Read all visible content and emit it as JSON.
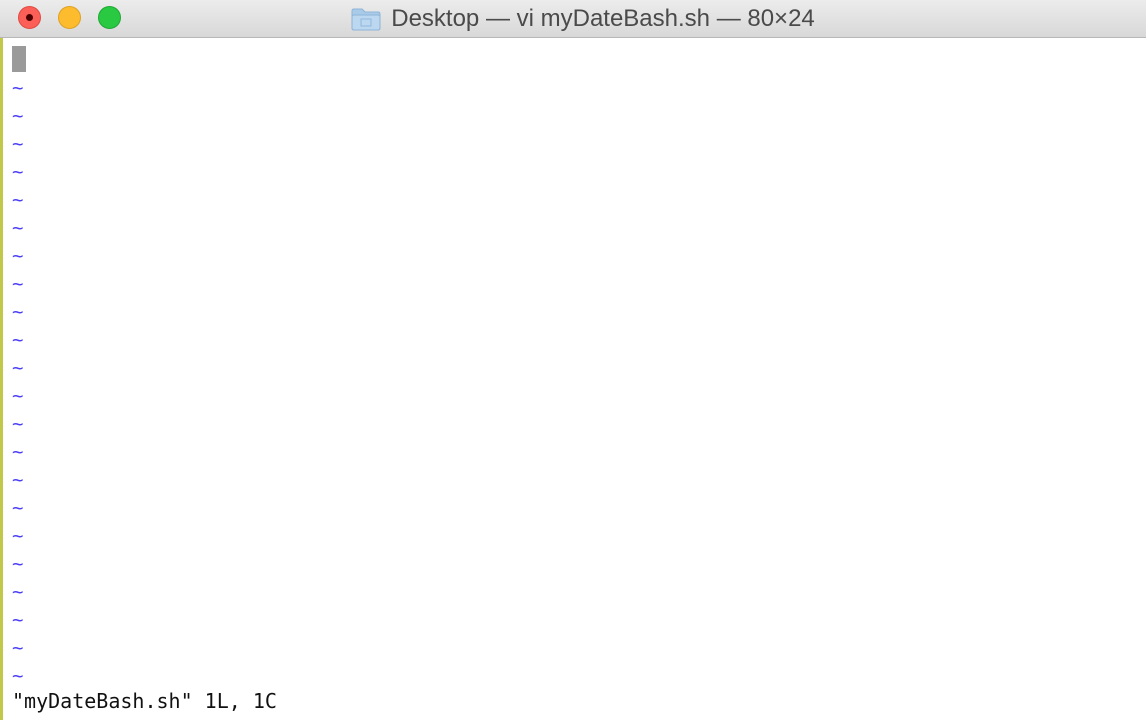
{
  "window": {
    "title": "Desktop — vi myDateBash.sh — 80×24",
    "folder_icon": "folder-icon",
    "controls": {
      "close": "close-icon",
      "minimize": "minimize-icon",
      "zoom": "zoom-icon"
    }
  },
  "editor": {
    "empty_line_marker": "~",
    "empty_line_count": 22,
    "status_message": "\"myDateBash.sh\" 1L, 1C",
    "cursor_color": "#9a9a9a",
    "tilde_color": "#4b3df5"
  },
  "colors": {
    "close": "#fc5f57",
    "minimize": "#fdbc2e",
    "zoom": "#29c941",
    "left_border": "#c2c84a"
  }
}
